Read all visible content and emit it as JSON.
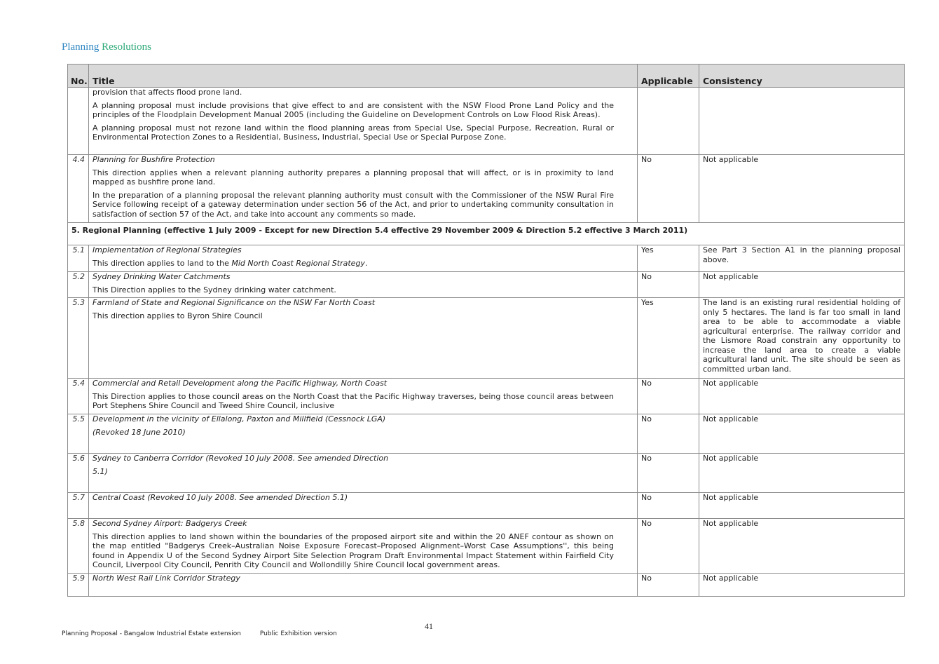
{
  "heading": {
    "word1": "Planning",
    "word2": "Resolutions"
  },
  "columns": {
    "no": "No.",
    "title": "Title",
    "applicable": "Applicable",
    "consistency": "Consistency"
  },
  "rows": {
    "cont": {
      "p0": "provision that affects flood prone land.",
      "p1": "A planning proposal must include provisions that give effect to and are consistent with the NSW Flood Prone Land Policy and the principles of the Floodplain Development Manual 2005 (including the Guideline on Development Controls on Low Flood Risk Areas).",
      "p2": "A planning proposal must not rezone land within the flood planning areas from Special Use, Special Purpose, Recreation, Rural or Environmental Protection Zones to a Residential, Business, Industrial, Special Use or Special Purpose Zone."
    },
    "r44": {
      "no": "4.4",
      "title": "Planning for Bushfire Protection",
      "p1": "This direction applies when a relevant planning authority prepares a planning proposal that will affect, or is in proximity to land mapped as bushfire prone land.",
      "p2": "In the preparation of a planning proposal the relevant planning authority must consult with the Commissioner of the NSW Rural Fire Service following receipt of a gateway determination under section 56 of the Act, and prior to undertaking community consultation in satisfaction of section 57 of the Act, and take into account any comments so made.",
      "applicable": "No",
      "consistency": "Not applicable"
    },
    "section5": "5. Regional Planning (effective 1 July 2009 - Except for new Direction 5.4 effective 29 November 2009 & Direction 5.2 effective 3 March 2011)",
    "r51": {
      "no": "5.1",
      "title": "Implementation of Regional Strategies",
      "desc_pre": "This direction applies to land to the ",
      "desc_it": "Mid North Coast Regional Strategy",
      "desc_post": ".",
      "applicable": "Yes",
      "consistency": "See Part 3 Section A1 in the planning proposal above."
    },
    "r52": {
      "no": "5.2",
      "title": "Sydney Drinking Water Catchments",
      "p1": "This Direction applies to the Sydney drinking water catchment.",
      "applicable": "No",
      "consistency": "Not applicable"
    },
    "r53": {
      "no": "5.3",
      "title": "Farmland of State and Regional Significance on the NSW Far North Coast",
      "p1": "This direction applies to Byron Shire Council",
      "applicable": "Yes",
      "consistency": "The land is an existing rural residential holding of only 5 hectares. The land is far too small in land area to be able to accommodate a viable agricultural enterprise. The railway corridor and the Lismore Road constrain any opportunity to increase the land area to create a viable agricultural land unit.  The site should be seen as committed urban land."
    },
    "r54": {
      "no": "5.4",
      "title": "Commercial and Retail Development along the Pacific Highway, North Coast",
      "p1": "This Direction applies to those council areas on the North Coast that the Pacific Highway traverses, being those council areas between Port Stephens Shire Council and Tweed Shire Council, inclusive",
      "applicable": "No",
      "consistency": "Not applicable"
    },
    "r55": {
      "no": "5.5",
      "title": "Development in the vicinity of Ellalong, Paxton and Millfield (Cessnock LGA)",
      "p1": "(Revoked 18 June 2010)",
      "applicable": "No",
      "consistency": "Not applicable"
    },
    "r56": {
      "no": "5.6",
      "title": "Sydney to Canberra Corridor (Revoked 10 July 2008. See amended Direction",
      "p1": "5.1)",
      "applicable": "No",
      "consistency": "Not applicable"
    },
    "r57": {
      "no": "5.7",
      "title": "Central Coast (Revoked 10 July 2008. See amended Direction 5.1)",
      "applicable": "No",
      "consistency": "Not applicable"
    },
    "r58": {
      "no": "5.8",
      "title": "Second Sydney Airport: Badgerys Creek",
      "p1": "This direction applies to land shown within the boundaries of the proposed airport site and within the 20 ANEF contour as shown on the map entitled \"Badgerys Creek–Australian Noise Exposure Forecast–Proposed Alignment–Worst Case Assumptions'', this being found in Appendix U of the Second Sydney Airport Site Selection Program Draft Environmental Impact Statement within Fairfield City Council, Liverpool City Council, Penrith City Council and Wollondilly Shire Council local government areas.",
      "applicable": "No",
      "consistency": "Not applicable"
    },
    "r59": {
      "no": "5.9",
      "title": "North West Rail Link Corridor Strategy",
      "applicable": "No",
      "consistency": "Not applicable"
    }
  },
  "page_number": "41",
  "footer": {
    "doc_title": "Planning Proposal - Bangalow Industrial Estate extension",
    "version": "Public Exhibition version"
  }
}
